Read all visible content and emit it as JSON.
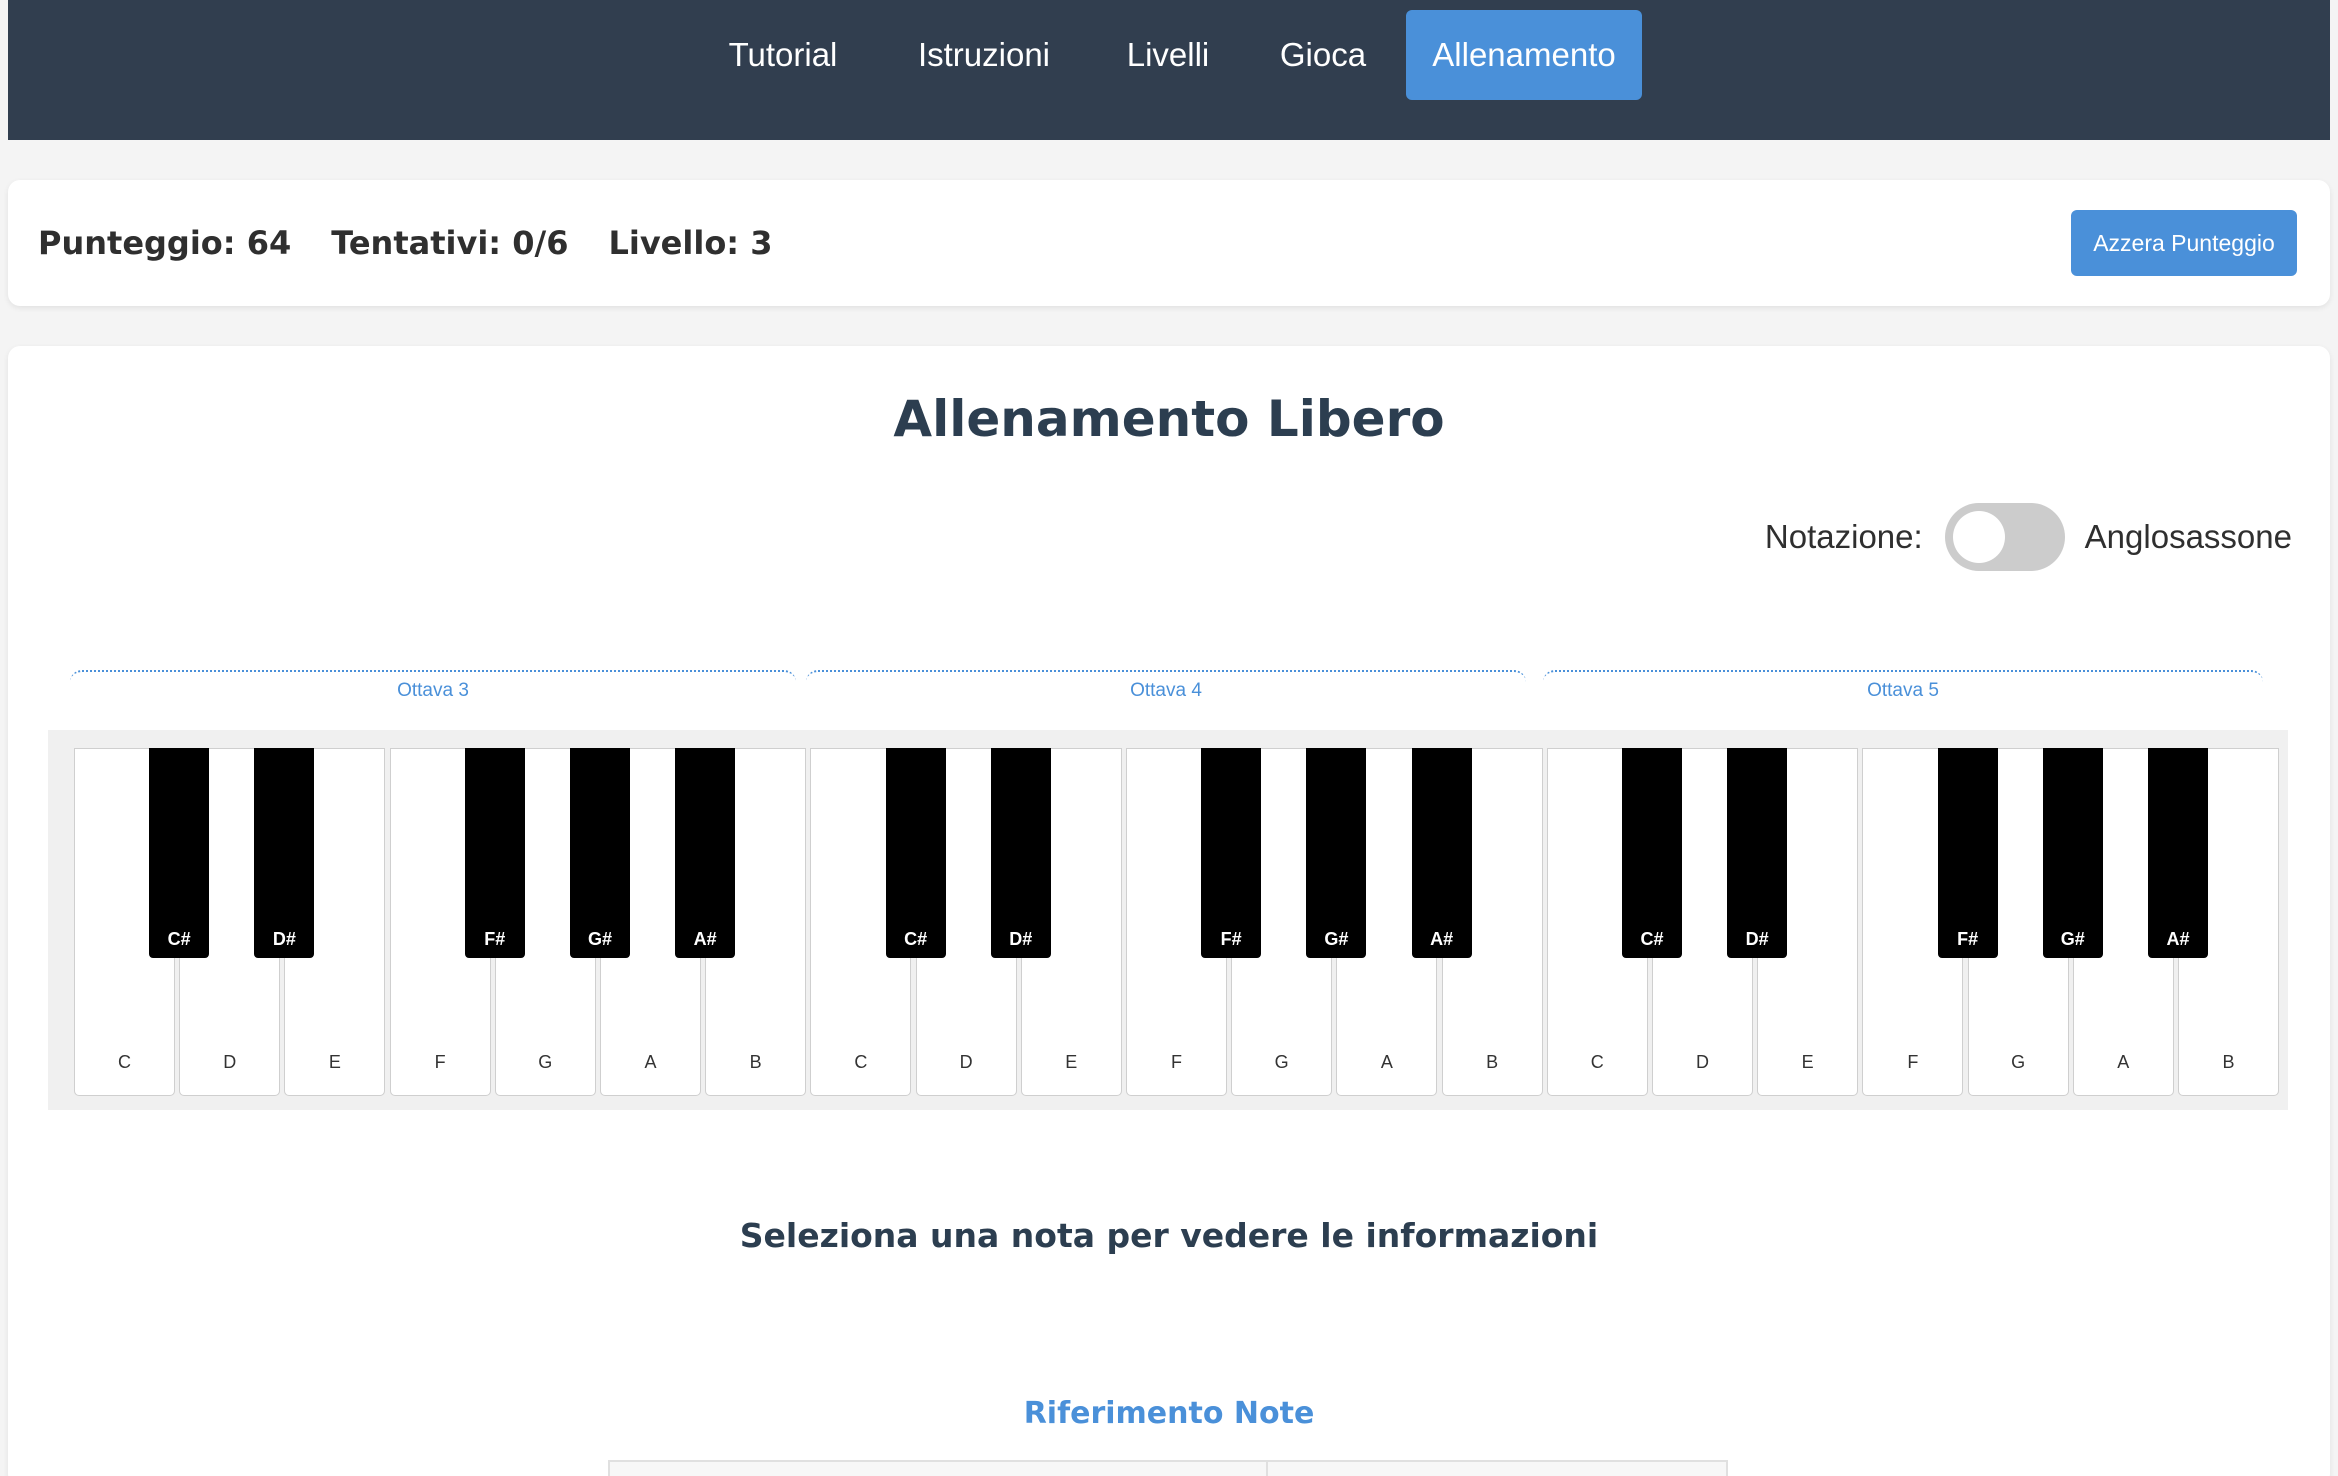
{
  "nav": {
    "tabs": [
      {
        "label": "Tutorial",
        "active": false
      },
      {
        "label": "Istruzioni",
        "active": false
      },
      {
        "label": "Livelli",
        "active": false
      },
      {
        "label": "Gioca",
        "active": false
      },
      {
        "label": "Allenamento",
        "active": true
      }
    ]
  },
  "score": {
    "punteggio": "Punteggio: 64",
    "tentativi": "Tentativi: 0/6",
    "livello": "Livello: 3",
    "reset_label": "Azzera Punteggio"
  },
  "main": {
    "title": "Allenamento Libero",
    "notation_label": "Notazione:",
    "notation_value": "Anglosassone",
    "notation_toggle_on": false,
    "octaves": [
      "Ottava 3",
      "Ottava 4",
      "Ottava 5"
    ],
    "white_keys": [
      "C",
      "D",
      "E",
      "F",
      "G",
      "A",
      "B"
    ],
    "black_keys": [
      "C#",
      "D#",
      "F#",
      "G#",
      "A#"
    ],
    "select_info": "Seleziona una nota per vedere le informazioni",
    "reference_title": "Riferimento Note"
  },
  "colors": {
    "nav_bg": "#313e4f",
    "accent": "#4a90d9",
    "heading": "#2c3e50"
  }
}
